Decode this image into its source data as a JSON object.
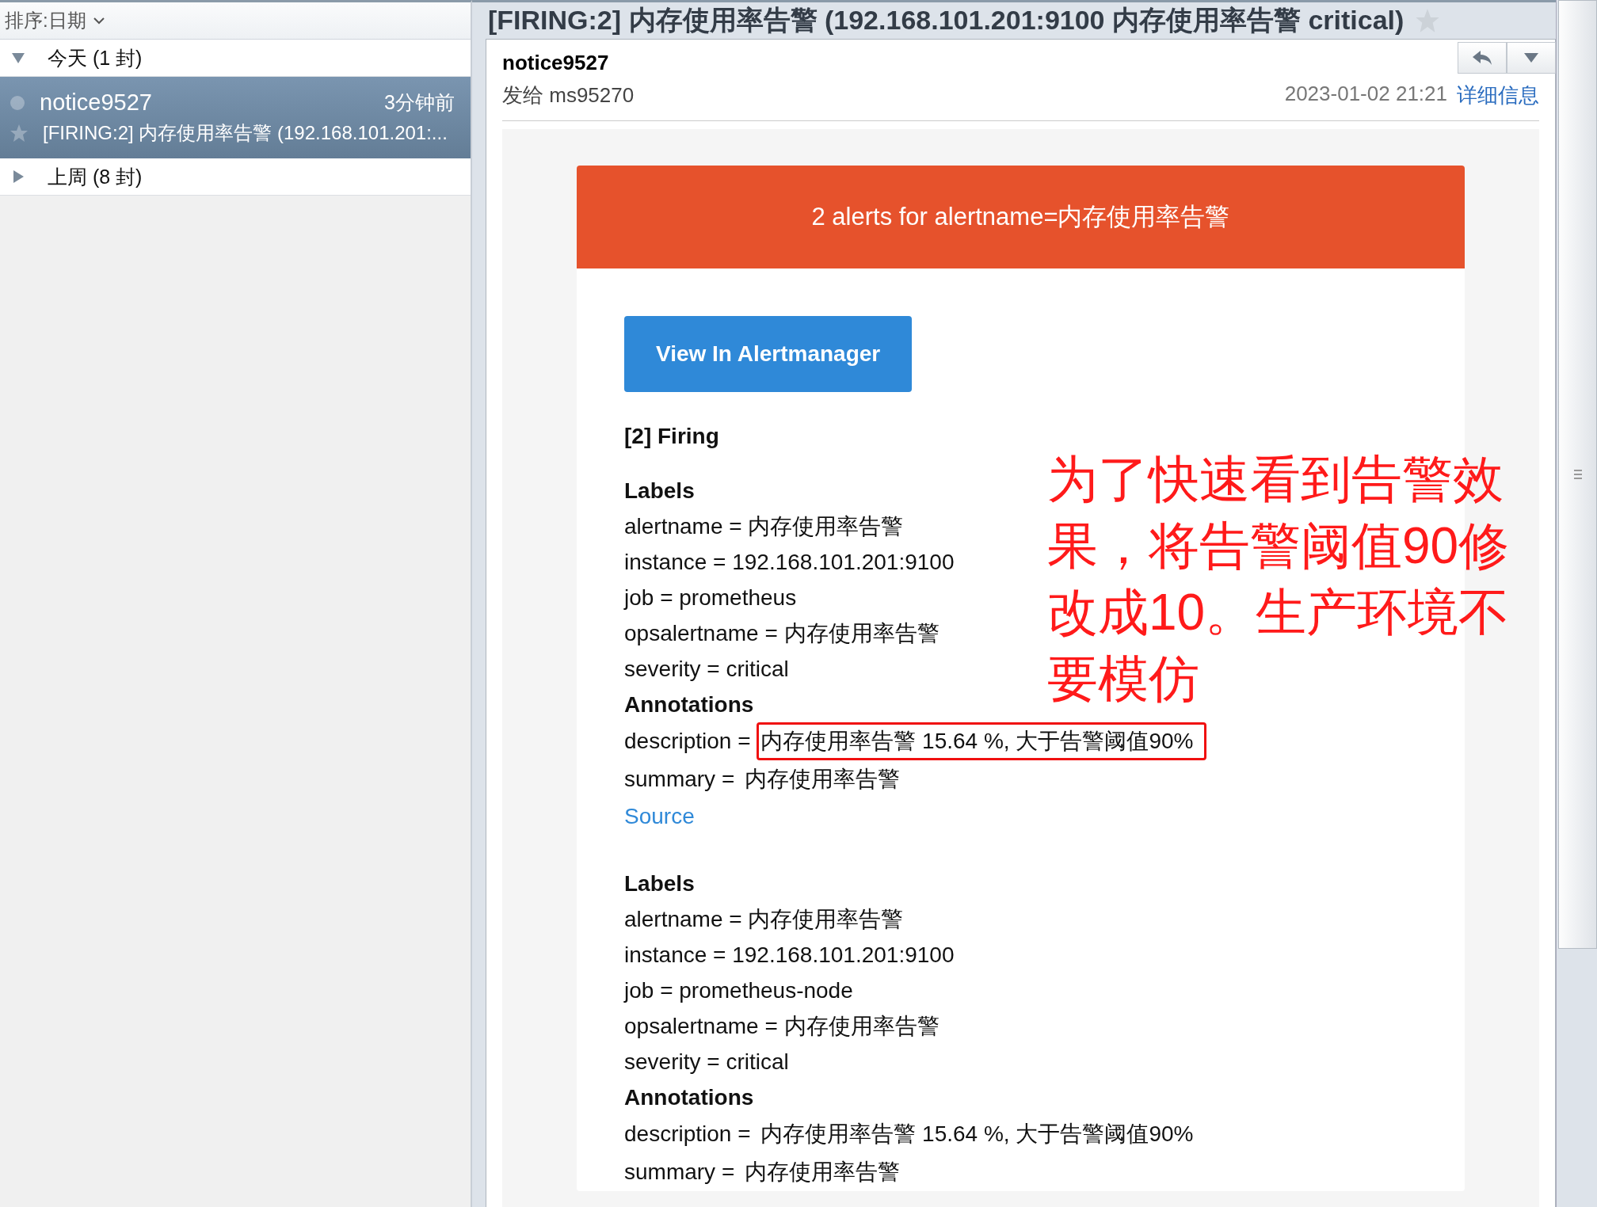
{
  "sidebar": {
    "sort_label": "排序:日期",
    "groups": [
      {
        "label": "今天 (1 封)",
        "expanded": true,
        "messages": [
          {
            "sender": "notice9527",
            "time": "3分钟前",
            "subject": "[FIRING:2] 内存使用率告警 (192.168.101.201:...",
            "selected": true
          }
        ]
      },
      {
        "label": "上周 (8 封)",
        "expanded": false
      }
    ]
  },
  "message": {
    "title": "[FIRING:2] 内存使用率告警 (192.168.101.201:9100 内存使用率告警 critical)",
    "from": "notice9527",
    "to": "发给 ms95270",
    "date": "2023-01-02 21:21",
    "details_link": "详细信息"
  },
  "email": {
    "banner": "2 alerts for alertname=内存使用率告警",
    "button": "View In Alertmanager",
    "section_title": "[2] Firing",
    "alerts": [
      {
        "labels_heading": "Labels",
        "labels": [
          "alertname = 内存使用率告警",
          "instance = 192.168.101.201:9100",
          "job = prometheus",
          "opsalertname = 内存使用率告警",
          "severity = critical"
        ],
        "annotations_heading": "Annotations",
        "annotations": [
          {
            "prefix": "description =",
            "value": "内存使用率告警 15.64 %, 大于告警阈值90%",
            "highlighted": true
          },
          {
            "prefix": "summary =",
            "value": "内存使用率告警",
            "highlighted": false
          }
        ],
        "source_link": "Source"
      },
      {
        "labels_heading": "Labels",
        "labels": [
          "alertname = 内存使用率告警",
          "instance = 192.168.101.201:9100",
          "job = prometheus-node",
          "opsalertname = 内存使用率告警",
          "severity = critical"
        ],
        "annotations_heading": "Annotations",
        "annotations": [
          {
            "prefix": "description =",
            "value": "内存使用率告警 15.64 %, 大于告警阈值90%",
            "highlighted": false
          },
          {
            "prefix": "summary =",
            "value": "内存使用率告警",
            "highlighted": false
          }
        ]
      }
    ]
  },
  "annotation_note": "为了快速看到告警效果，将告警阈值90修改成10。生产环境不要模仿"
}
